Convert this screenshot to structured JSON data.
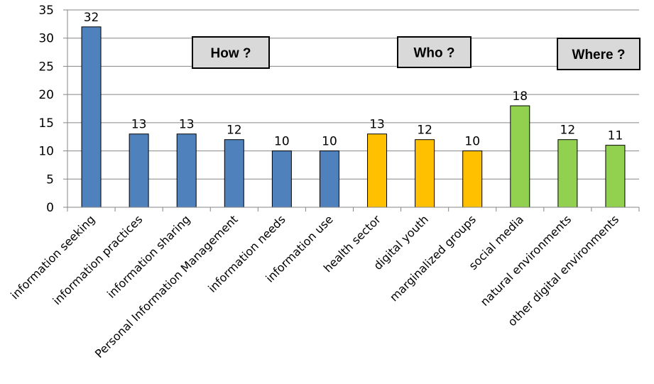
{
  "chart_data": {
    "type": "bar",
    "title": "",
    "xlabel": "",
    "ylabel": "",
    "ylim": [
      0,
      35
    ],
    "yticks": [
      0,
      5,
      10,
      15,
      20,
      25,
      30,
      35
    ],
    "grid": true,
    "legend": "none",
    "categories": [
      "information seeking",
      "information practices",
      "information sharing",
      "Personal Information Management",
      "information needs",
      "information use",
      "health sector",
      "digital youth",
      "marginalized groups",
      "social media",
      "natural environments",
      "other digital environments"
    ],
    "values": [
      32,
      13,
      13,
      12,
      10,
      10,
      13,
      12,
      10,
      18,
      12,
      11
    ],
    "groups": [
      {
        "name": "How ?",
        "color": "#4F81BD",
        "categories": [
          0,
          1,
          2,
          3,
          4,
          5
        ]
      },
      {
        "name": "Who ?",
        "color": "#FFC000",
        "categories": [
          6,
          7,
          8
        ]
      },
      {
        "name": "Where ?",
        "color": "#92D050",
        "categories": [
          9,
          10,
          11
        ]
      }
    ],
    "annotations": [
      "How ?",
      "Who ?",
      "Where ?"
    ]
  }
}
